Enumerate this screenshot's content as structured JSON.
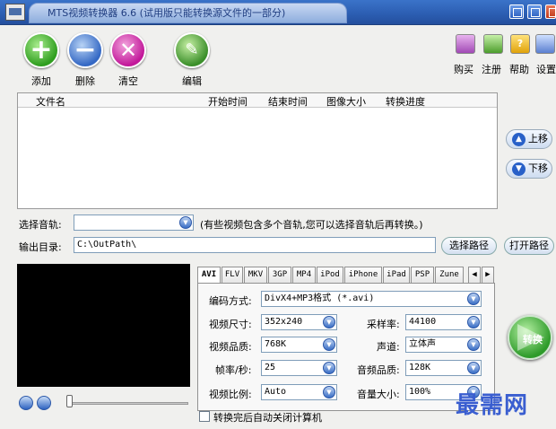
{
  "window": {
    "title": "MTS视频转换器 6.6 (试用版只能转换源文件的一部分)"
  },
  "toolbar": {
    "add_label": "添加",
    "delete_label": "删除",
    "clear_label": "清空",
    "edit_label": "编辑",
    "buy_label": "购买",
    "register_label": "注册",
    "help_label": "帮助",
    "settings_label": "设置"
  },
  "filelist": {
    "columns": [
      "文件名",
      "开始时间",
      "结束时间",
      "图像大小",
      "转换进度"
    ],
    "rows": []
  },
  "side": {
    "move_up": "上移",
    "move_down": "下移"
  },
  "audio": {
    "label": "选择音轨:",
    "value": "",
    "hint": "(有些视频包含多个音轨,您可以选择音轨后再转换。)"
  },
  "output": {
    "label": "输出目录:",
    "path": "C:\\OutPath\\",
    "choose_button": "选择路径",
    "open_button": "打开路径"
  },
  "tabs": [
    "AVI",
    "FLV",
    "MKV",
    "3GP",
    "MP4",
    "iPod",
    "iPhone",
    "iPad",
    "PSP",
    "Zune"
  ],
  "settings": {
    "encoder_label": "编码方式:",
    "encoder_value": "DivX4+MP3格式 (*.avi)",
    "size_label": "视频尺寸:",
    "size_value": "352x240",
    "quality_label": "视频品质:",
    "quality_value": "768K",
    "fps_label": "帧率/秒:",
    "fps_value": "25",
    "ratio_label": "视频比例:",
    "ratio_value": "Auto",
    "samplerate_label": "采样率:",
    "samplerate_value": "44100",
    "channel_label": "声道:",
    "channel_value": "立体声",
    "audioquality_label": "音频品质:",
    "audioquality_value": "128K",
    "volume_label": "音量大小:",
    "volume_value": "100%"
  },
  "convert_label": "转换",
  "shutdown_label": "转换完后自动关闭计算机",
  "watermark": "最需网",
  "colors": {
    "accent": "#2b5db1",
    "go_green": "#2e9b2a"
  }
}
